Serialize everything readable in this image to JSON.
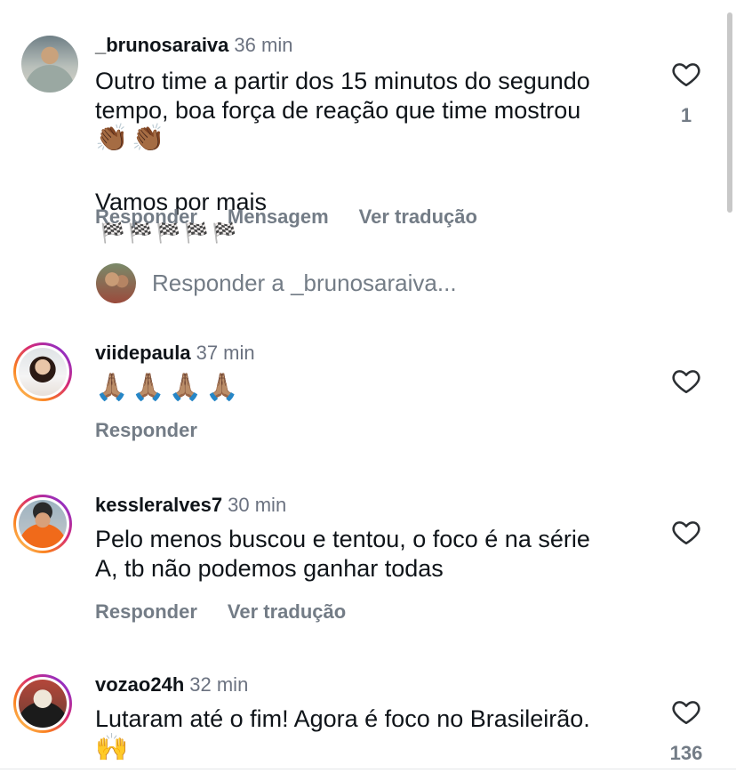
{
  "comments": [
    {
      "username": "_brunosaraiva",
      "time": "36 min",
      "text": "Outro time a partir dos 15 minutos do segundo\ntempo, boa força de reação que time mostrou",
      "emojis_line1": "👏🏾👏🏾",
      "text2": "Vamos por mais",
      "emojis_line2": "🏁🏁🏁🏁🏁",
      "actions": [
        "Responder",
        "Mensagem",
        "Ver tradução"
      ],
      "likes": "1"
    },
    {
      "username": "viidepaula",
      "time": "37 min",
      "emojis": "🙏🏽🙏🏽🙏🏽🙏🏽",
      "actions": [
        "Responder"
      ]
    },
    {
      "username": "kessleralves7",
      "time": "30 min",
      "text": "Pelo menos buscou e tentou, o foco é na série\nA, tb não podemos ganhar todas",
      "actions": [
        "Responder",
        "Ver tradução"
      ]
    },
    {
      "username": "vozao24h",
      "time": "32 min",
      "text": "Lutaram até o fim! Agora é foco no Brasileirão.",
      "emojis": "🙌",
      "likes": "136"
    }
  ],
  "reply_prompt": "Responder a _brunosaraiva...",
  "icons": {
    "like": "heart-outline-icon"
  }
}
